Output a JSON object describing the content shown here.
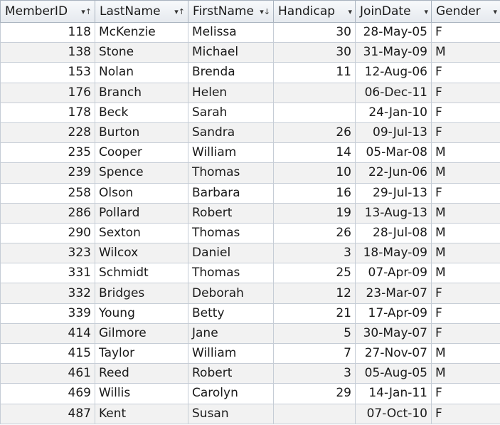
{
  "columns": [
    {
      "key": "member_id",
      "label": "MemberID",
      "sort_icon": "sort-ascending-icon",
      "glyph": "▾↑"
    },
    {
      "key": "last_name",
      "label": "LastName",
      "sort_icon": "sort-ascending-icon",
      "glyph": "▾↑"
    },
    {
      "key": "first_name",
      "label": "FirstName",
      "sort_icon": "sort-descending-icon",
      "glyph": "▾↓"
    },
    {
      "key": "handicap",
      "label": "Handicap",
      "sort_icon": "dropdown-arrow-icon",
      "glyph": "▾"
    },
    {
      "key": "join_date",
      "label": "JoinDate",
      "sort_icon": "dropdown-arrow-icon",
      "glyph": "▾"
    },
    {
      "key": "gender",
      "label": "Gender",
      "sort_icon": "dropdown-arrow-icon",
      "glyph": "▾"
    }
  ],
  "rows": [
    [
      "118",
      "McKenzie",
      "Melissa",
      "30",
      "28-May-05",
      "F"
    ],
    [
      "138",
      "Stone",
      "Michael",
      "30",
      "31-May-09",
      "M"
    ],
    [
      "153",
      "Nolan",
      "Brenda",
      "11",
      "12-Aug-06",
      "F"
    ],
    [
      "176",
      "Branch",
      "Helen",
      "",
      "06-Dec-11",
      "F"
    ],
    [
      "178",
      "Beck",
      "Sarah",
      "",
      "24-Jan-10",
      "F"
    ],
    [
      "228",
      "Burton",
      "Sandra",
      "26",
      "09-Jul-13",
      "F"
    ],
    [
      "235",
      "Cooper",
      "William",
      "14",
      "05-Mar-08",
      "M"
    ],
    [
      "239",
      "Spence",
      "Thomas",
      "10",
      "22-Jun-06",
      "M"
    ],
    [
      "258",
      "Olson",
      "Barbara",
      "16",
      "29-Jul-13",
      "F"
    ],
    [
      "286",
      "Pollard",
      "Robert",
      "19",
      "13-Aug-13",
      "M"
    ],
    [
      "290",
      "Sexton",
      "Thomas",
      "26",
      "28-Jul-08",
      "M"
    ],
    [
      "323",
      "Wilcox",
      "Daniel",
      "3",
      "18-May-09",
      "M"
    ],
    [
      "331",
      "Schmidt",
      "Thomas",
      "25",
      "07-Apr-09",
      "M"
    ],
    [
      "332",
      "Bridges",
      "Deborah",
      "12",
      "23-Mar-07",
      "F"
    ],
    [
      "339",
      "Young",
      "Betty",
      "21",
      "17-Apr-09",
      "F"
    ],
    [
      "414",
      "Gilmore",
      "Jane",
      "5",
      "30-May-07",
      "F"
    ],
    [
      "415",
      "Taylor",
      "William",
      "7",
      "27-Nov-07",
      "M"
    ],
    [
      "461",
      "Reed",
      "Robert",
      "3",
      "05-Aug-05",
      "M"
    ],
    [
      "469",
      "Willis",
      "Carolyn",
      "29",
      "14-Jan-11",
      "F"
    ],
    [
      "487",
      "Kent",
      "Susan",
      "",
      "07-Oct-10",
      "F"
    ]
  ]
}
